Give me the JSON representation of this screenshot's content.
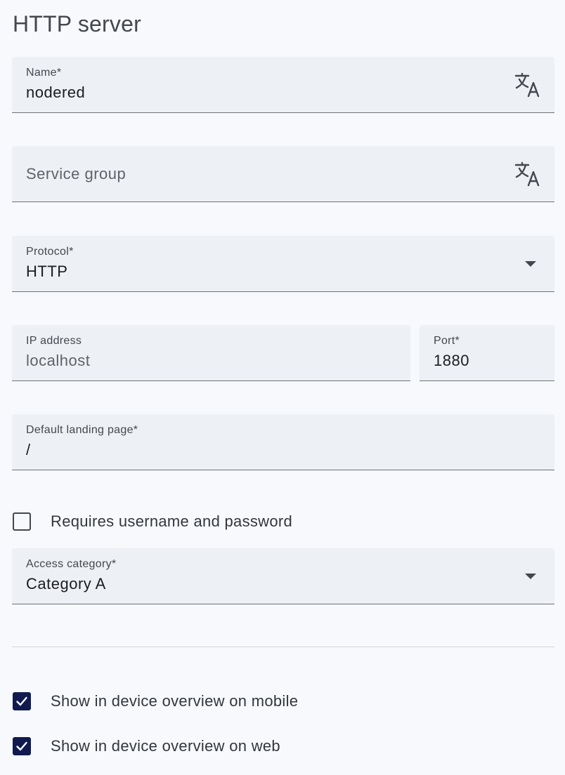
{
  "page": {
    "title": "HTTP server"
  },
  "fields": {
    "name": {
      "label": "Name*",
      "value": "nodered",
      "icon": "translate-icon"
    },
    "service_group": {
      "placeholder": "Service group",
      "icon": "translate-icon"
    },
    "protocol": {
      "label": "Protocol*",
      "value": "HTTP"
    },
    "ip_address": {
      "label": "IP address",
      "value": "localhost"
    },
    "port": {
      "label": "Port*",
      "value": "1880"
    },
    "landing_page": {
      "label": "Default landing page*",
      "value": "/"
    },
    "access_category": {
      "label": "Access category*",
      "value": "Category A"
    }
  },
  "checkboxes": {
    "requires_auth": {
      "label": "Requires username and password",
      "checked": false
    },
    "show_mobile": {
      "label": "Show in device overview on mobile",
      "checked": true
    },
    "show_web": {
      "label": "Show in device overview on web",
      "checked": true
    }
  },
  "colors": {
    "accent": "#101a4f",
    "field_bg": "#edf0f4",
    "page_bg": "#f7f9fd"
  }
}
